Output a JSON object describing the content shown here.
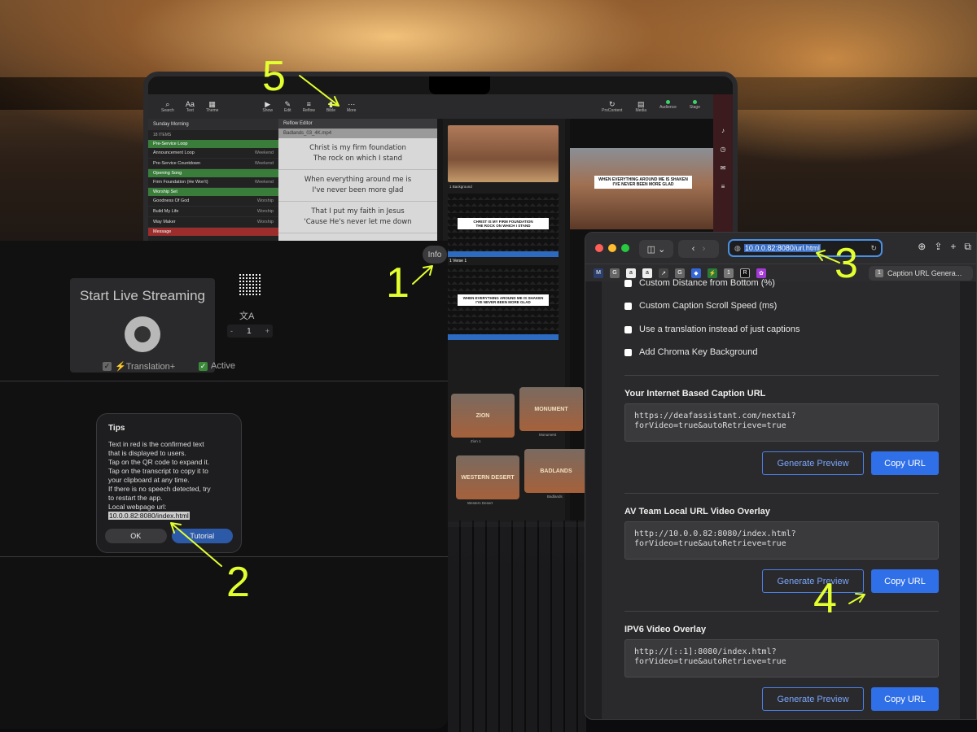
{
  "propresenter": {
    "toolbar": [
      "Search",
      "Text",
      "Theme",
      "Show",
      "Edit",
      "Reflow",
      "Bible",
      "More"
    ],
    "toolbar_right": [
      "ProContent",
      "Media",
      "Audience",
      "Stage"
    ],
    "library": {
      "playlist": "Sunday Morning",
      "count": "18 ITEMS",
      "rows": [
        {
          "group": "Pre-Service Loop"
        },
        {
          "name": "Announcement Loop",
          "tag": "Weekend"
        },
        {
          "name": "Pre-Service Countdown",
          "tag": "Weekend"
        },
        {
          "group": "Opening Song"
        },
        {
          "name": "Firm Foundation (He Won't)",
          "tag": "Weekend"
        },
        {
          "group": "Worship Set"
        },
        {
          "name": "Goodness Of God",
          "tag": "Worship"
        },
        {
          "name": "Build My Life",
          "tag": "Worship"
        },
        {
          "name": "Way Maker",
          "tag": "Worship"
        },
        {
          "group": "Message",
          "type": "msg"
        }
      ]
    },
    "reflow_title": "Reflow Editor",
    "reflow_file": "Badlands_03_4K.mp4",
    "slides": [
      [
        "Christ is my firm foundation",
        "The rock on which I stand"
      ],
      [
        "When everything around me is",
        "I've never been more glad"
      ],
      [
        "That I put my faith in Jesus",
        "'Cause He's never let me down"
      ]
    ],
    "thumb_caption": "Badlands_03_4K.mp4",
    "thumb_label": "1 Background",
    "lower_thirds": [
      [
        "CHRIST IS MY FIRM FOUNDATION",
        "THE ROCK ON WHICH I STAND"
      ],
      [
        "WHEN EVERYTHING AROUND ME IS SHAKEN",
        "I'VE NEVER BEEN MORE GLAD"
      ]
    ],
    "verse_label": "1 Verse 1",
    "output_text": [
      "WHEN EVERYTHING AROUND ME IS SHAKEN",
      "I'VE NEVER BEEN MORE GLAD"
    ],
    "media": [
      {
        "title": "ZION",
        "caption": "Zion 1"
      },
      {
        "title": "MONUMENT",
        "caption": "Monument"
      },
      {
        "title": "WESTERN DESERT",
        "caption": "Western Desert"
      },
      {
        "title": "BADLANDS",
        "caption": "Badlands"
      }
    ]
  },
  "app": {
    "info_label": "Info",
    "stream_title": "Start Live Streaming",
    "stepper_value": "1",
    "stepper_minus": "-",
    "stepper_plus": "+",
    "translation_label": "⚡Translation+",
    "active_label": "Active",
    "tips": {
      "title": "Tips",
      "lines": [
        "Text in red is the confirmed text",
        "that is displayed to users.",
        "Tap on the QR code to expand it.",
        "Tap on the transcript to copy it to",
        "your clipboard at any time.",
        "If there is no speech detected, try",
        "to restart the app.",
        "Local webpage url:"
      ],
      "url": "10.0.0.82:8080/index.html",
      "ok": "OK",
      "tutorial": "Tutorial"
    }
  },
  "browser": {
    "address": "10.0.0.82:8080/url.html",
    "tab_title": "Caption URL Genera...",
    "tab_number": "1",
    "favorites": [
      "M",
      "G",
      "a",
      "a",
      "↗",
      "G",
      "◆",
      "⚡",
      "1",
      "R",
      "✿"
    ],
    "options": [
      "Custom Distance from Bottom (%)",
      "Custom Caption Scroll Speed (ms)",
      "Use a translation instead of just captions",
      "Add Chroma Key Background"
    ],
    "sections": [
      {
        "title": "Your Internet Based Caption URL",
        "url_lines": [
          "https://deafassistant.com/nextai?",
          "forVideo=true&autoRetrieve=true"
        ],
        "preview": "Generate Preview",
        "copy": "Copy URL"
      },
      {
        "title": "AV Team Local URL Video Overlay",
        "url_lines": [
          "http://10.0.0.82:8080/index.html?",
          "forVideo=true&autoRetrieve=true"
        ],
        "preview": "Generate Preview",
        "copy": "Copy URL"
      },
      {
        "title": "IPV6 Video Overlay",
        "url_lines": [
          "http://[::1]:8080/index.html?",
          "forVideo=true&autoRetrieve=true"
        ],
        "preview": "Generate Preview",
        "copy": "Copy URL"
      }
    ]
  },
  "callouts": [
    "1",
    "2",
    "3",
    "4",
    "5"
  ],
  "colors": {
    "callout": "#e3ff2e",
    "accent_blue": "#2f6fe8",
    "worship_group": "#3a7d3b",
    "message_group": "#9b2d2d"
  }
}
